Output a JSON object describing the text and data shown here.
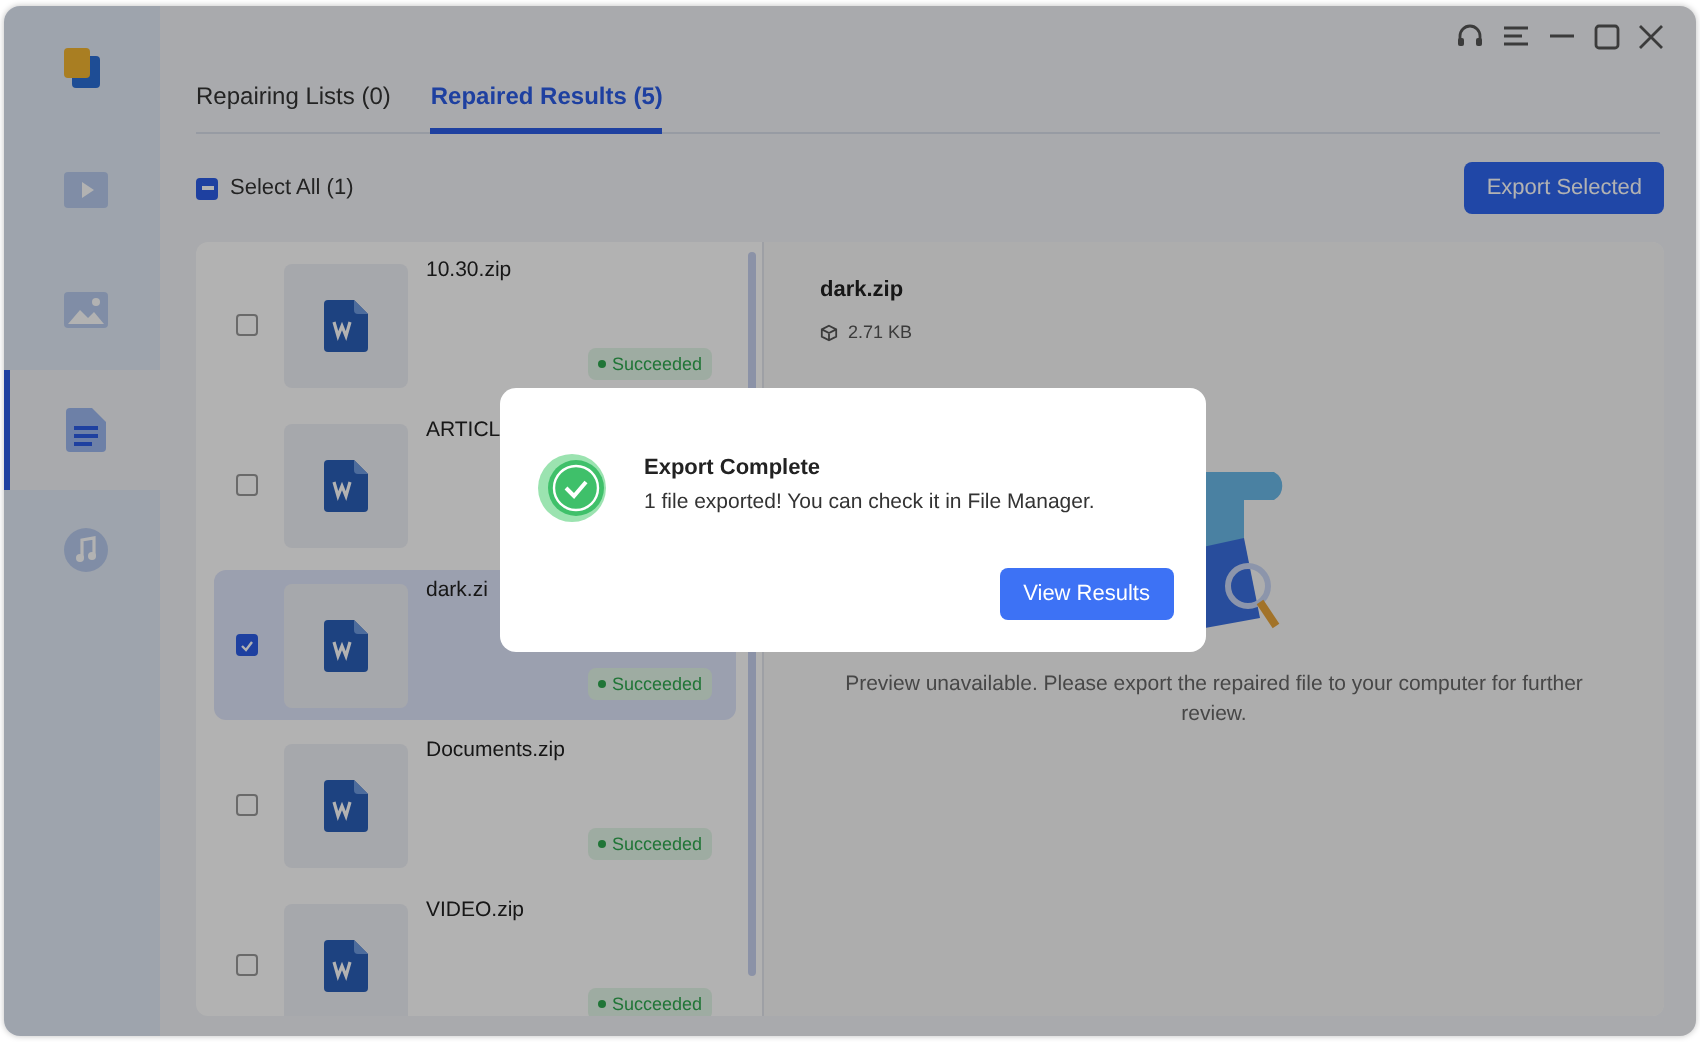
{
  "sidebar": {
    "items": [
      {
        "kind": "video",
        "selected": false
      },
      {
        "kind": "image",
        "selected": false
      },
      {
        "kind": "document",
        "selected": true
      },
      {
        "kind": "audio",
        "selected": false
      }
    ]
  },
  "tabs": [
    {
      "label": "Repairing Lists (0)",
      "selected": false
    },
    {
      "label": "Repaired Results (5)",
      "selected": true
    }
  ],
  "select_all": {
    "label": "Select All (1)",
    "indeterminate": true
  },
  "export_button": "Export Selected",
  "files": [
    {
      "name": "10.30.zip",
      "checked": false,
      "selected": false,
      "status": "Succeeded"
    },
    {
      "name": "ARTICL",
      "checked": false,
      "selected": false
    },
    {
      "name": "dark.zi",
      "checked": true,
      "selected": true,
      "status": "Succeeded"
    },
    {
      "name": "Documents.zip",
      "checked": false,
      "selected": false,
      "status": "Succeeded"
    },
    {
      "name": "VIDEO.zip",
      "checked": false,
      "selected": false,
      "status": "Succeeded"
    }
  ],
  "detail": {
    "name": "dark.zip",
    "size": "2.71 KB",
    "message": "Preview unavailable. Please export the repaired file to your computer for further review."
  },
  "dialog": {
    "title": "Export Complete",
    "message": "1 file exported! You can check it in File Manager.",
    "button": "View Results"
  }
}
